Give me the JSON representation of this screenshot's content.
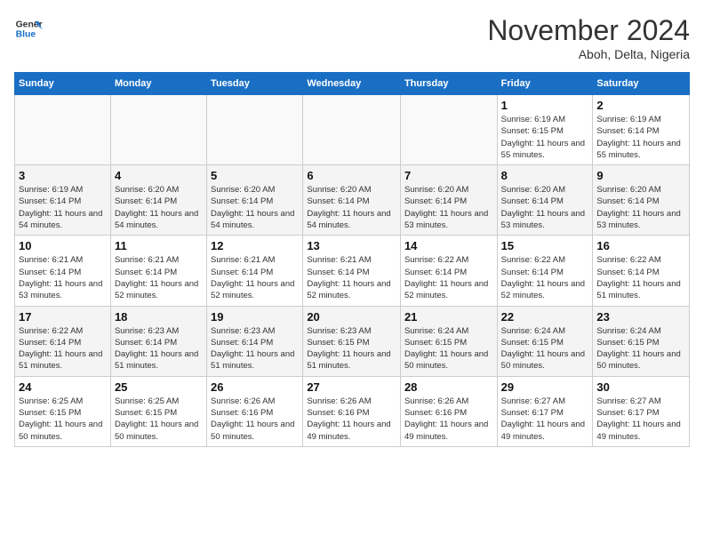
{
  "logo": {
    "line1": "General",
    "line2": "Blue"
  },
  "title": "November 2024",
  "location": "Aboh, Delta, Nigeria",
  "days_of_week": [
    "Sunday",
    "Monday",
    "Tuesday",
    "Wednesday",
    "Thursday",
    "Friday",
    "Saturday"
  ],
  "weeks": [
    [
      {
        "day": "",
        "info": ""
      },
      {
        "day": "",
        "info": ""
      },
      {
        "day": "",
        "info": ""
      },
      {
        "day": "",
        "info": ""
      },
      {
        "day": "",
        "info": ""
      },
      {
        "day": "1",
        "info": "Sunrise: 6:19 AM\nSunset: 6:15 PM\nDaylight: 11 hours and 55 minutes."
      },
      {
        "day": "2",
        "info": "Sunrise: 6:19 AM\nSunset: 6:14 PM\nDaylight: 11 hours and 55 minutes."
      }
    ],
    [
      {
        "day": "3",
        "info": "Sunrise: 6:19 AM\nSunset: 6:14 PM\nDaylight: 11 hours and 54 minutes."
      },
      {
        "day": "4",
        "info": "Sunrise: 6:20 AM\nSunset: 6:14 PM\nDaylight: 11 hours and 54 minutes."
      },
      {
        "day": "5",
        "info": "Sunrise: 6:20 AM\nSunset: 6:14 PM\nDaylight: 11 hours and 54 minutes."
      },
      {
        "day": "6",
        "info": "Sunrise: 6:20 AM\nSunset: 6:14 PM\nDaylight: 11 hours and 54 minutes."
      },
      {
        "day": "7",
        "info": "Sunrise: 6:20 AM\nSunset: 6:14 PM\nDaylight: 11 hours and 53 minutes."
      },
      {
        "day": "8",
        "info": "Sunrise: 6:20 AM\nSunset: 6:14 PM\nDaylight: 11 hours and 53 minutes."
      },
      {
        "day": "9",
        "info": "Sunrise: 6:20 AM\nSunset: 6:14 PM\nDaylight: 11 hours and 53 minutes."
      }
    ],
    [
      {
        "day": "10",
        "info": "Sunrise: 6:21 AM\nSunset: 6:14 PM\nDaylight: 11 hours and 53 minutes."
      },
      {
        "day": "11",
        "info": "Sunrise: 6:21 AM\nSunset: 6:14 PM\nDaylight: 11 hours and 52 minutes."
      },
      {
        "day": "12",
        "info": "Sunrise: 6:21 AM\nSunset: 6:14 PM\nDaylight: 11 hours and 52 minutes."
      },
      {
        "day": "13",
        "info": "Sunrise: 6:21 AM\nSunset: 6:14 PM\nDaylight: 11 hours and 52 minutes."
      },
      {
        "day": "14",
        "info": "Sunrise: 6:22 AM\nSunset: 6:14 PM\nDaylight: 11 hours and 52 minutes."
      },
      {
        "day": "15",
        "info": "Sunrise: 6:22 AM\nSunset: 6:14 PM\nDaylight: 11 hours and 52 minutes."
      },
      {
        "day": "16",
        "info": "Sunrise: 6:22 AM\nSunset: 6:14 PM\nDaylight: 11 hours and 51 minutes."
      }
    ],
    [
      {
        "day": "17",
        "info": "Sunrise: 6:22 AM\nSunset: 6:14 PM\nDaylight: 11 hours and 51 minutes."
      },
      {
        "day": "18",
        "info": "Sunrise: 6:23 AM\nSunset: 6:14 PM\nDaylight: 11 hours and 51 minutes."
      },
      {
        "day": "19",
        "info": "Sunrise: 6:23 AM\nSunset: 6:14 PM\nDaylight: 11 hours and 51 minutes."
      },
      {
        "day": "20",
        "info": "Sunrise: 6:23 AM\nSunset: 6:15 PM\nDaylight: 11 hours and 51 minutes."
      },
      {
        "day": "21",
        "info": "Sunrise: 6:24 AM\nSunset: 6:15 PM\nDaylight: 11 hours and 50 minutes."
      },
      {
        "day": "22",
        "info": "Sunrise: 6:24 AM\nSunset: 6:15 PM\nDaylight: 11 hours and 50 minutes."
      },
      {
        "day": "23",
        "info": "Sunrise: 6:24 AM\nSunset: 6:15 PM\nDaylight: 11 hours and 50 minutes."
      }
    ],
    [
      {
        "day": "24",
        "info": "Sunrise: 6:25 AM\nSunset: 6:15 PM\nDaylight: 11 hours and 50 minutes."
      },
      {
        "day": "25",
        "info": "Sunrise: 6:25 AM\nSunset: 6:15 PM\nDaylight: 11 hours and 50 minutes."
      },
      {
        "day": "26",
        "info": "Sunrise: 6:26 AM\nSunset: 6:16 PM\nDaylight: 11 hours and 50 minutes."
      },
      {
        "day": "27",
        "info": "Sunrise: 6:26 AM\nSunset: 6:16 PM\nDaylight: 11 hours and 49 minutes."
      },
      {
        "day": "28",
        "info": "Sunrise: 6:26 AM\nSunset: 6:16 PM\nDaylight: 11 hours and 49 minutes."
      },
      {
        "day": "29",
        "info": "Sunrise: 6:27 AM\nSunset: 6:17 PM\nDaylight: 11 hours and 49 minutes."
      },
      {
        "day": "30",
        "info": "Sunrise: 6:27 AM\nSunset: 6:17 PM\nDaylight: 11 hours and 49 minutes."
      }
    ]
  ]
}
